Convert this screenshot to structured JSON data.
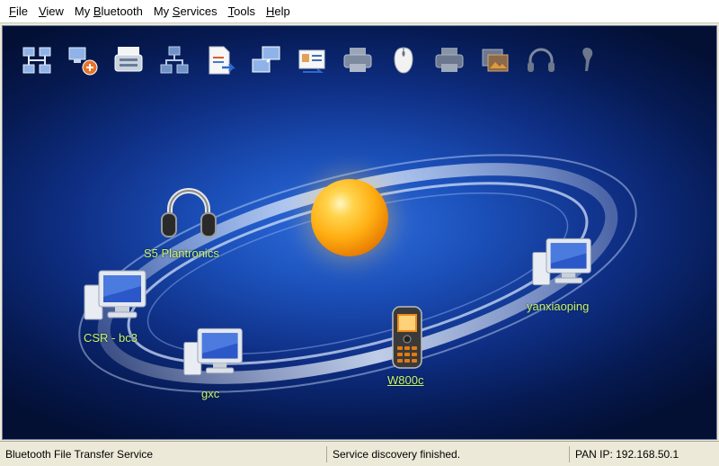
{
  "menu": {
    "items": [
      {
        "acc": "F",
        "rest": "ile"
      },
      {
        "acc": "V",
        "rest": "iew"
      },
      {
        "pre": "My ",
        "acc": "B",
        "rest": "luetooth"
      },
      {
        "pre": "My ",
        "acc": "S",
        "rest": "ervices"
      },
      {
        "acc": "T",
        "rest": "ools"
      },
      {
        "acc": "H",
        "rest": "elp"
      }
    ]
  },
  "toolbar": {
    "icons": [
      "network-tree-icon",
      "dialup-network-icon",
      "fax-icon",
      "lan-access-icon",
      "file-transfer-icon",
      "personal-network-icon",
      "business-card-icon",
      "printer-icon",
      "mouse-icon",
      "printer-alt-icon",
      "image-transfer-icon",
      "headphones-icon",
      "headset-icon"
    ]
  },
  "devices": [
    {
      "label": "S5 Plantronics",
      "icon": "headphones-icon"
    },
    {
      "label": "CSR - bc3",
      "icon": "computer-icon"
    },
    {
      "label": "gxc",
      "icon": "computer-icon"
    },
    {
      "label": "W800c",
      "icon": "mobile-phone-icon"
    },
    {
      "label": "yanxiaoping",
      "icon": "computer-icon"
    }
  ],
  "status": {
    "left": "Bluetooth File Transfer Service",
    "middle": "Service discovery finished.",
    "right": "PAN IP: 192.168.50.1"
  },
  "colors": {
    "canvas_bg": "#0f2f85",
    "orb": "#ffae12",
    "device_label": "#c9f26a"
  }
}
